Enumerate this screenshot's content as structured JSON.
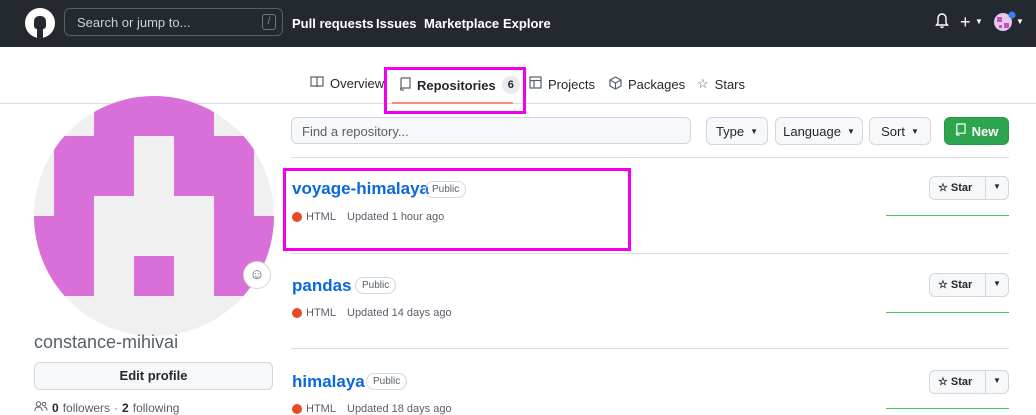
{
  "header": {
    "search_placeholder": "Search or jump to...",
    "search_shortcut": "/",
    "nav": [
      "Pull requests",
      "Issues",
      "Marketplace",
      "Explore"
    ],
    "icons": [
      "github-logo",
      "bell-icon",
      "plus-icon",
      "avatar-icon"
    ]
  },
  "tabs": [
    {
      "label": "Overview",
      "icon": "book-icon"
    },
    {
      "label": "Repositories",
      "icon": "repo-icon",
      "count": "6"
    },
    {
      "label": "Projects",
      "icon": "table-icon"
    },
    {
      "label": "Packages",
      "icon": "package-icon"
    },
    {
      "label": "Stars",
      "icon": "star-icon"
    }
  ],
  "profile": {
    "username": "constance-mihivai",
    "edit_label": "Edit profile",
    "followers_count": "0",
    "followers_label": "followers",
    "separator": "·",
    "following_count": "2",
    "following_label": "following"
  },
  "filters": {
    "search_placeholder": "Find a repository...",
    "type_label": "Type",
    "language_label": "Language",
    "sort_label": "Sort",
    "new_label": "New"
  },
  "repos": [
    {
      "name": "voyage-himalaya",
      "visibility": "Public",
      "language": "HTML",
      "updated": "Updated 1 hour ago"
    },
    {
      "name": "pandas",
      "visibility": "Public",
      "language": "HTML",
      "updated": "Updated 14 days ago"
    },
    {
      "name": "himalaya",
      "visibility": "Public",
      "language": "HTML",
      "updated": "Updated 18 days ago"
    }
  ],
  "star_label": "Star",
  "colors": {
    "header_bg": "#24292f",
    "accent_link": "#0969da",
    "new_button": "#2da44e",
    "html_lang": "#e34c26",
    "avatar_pink": "#d970da",
    "highlight": "#f000f0",
    "tab_underline": "#fd8c73"
  }
}
